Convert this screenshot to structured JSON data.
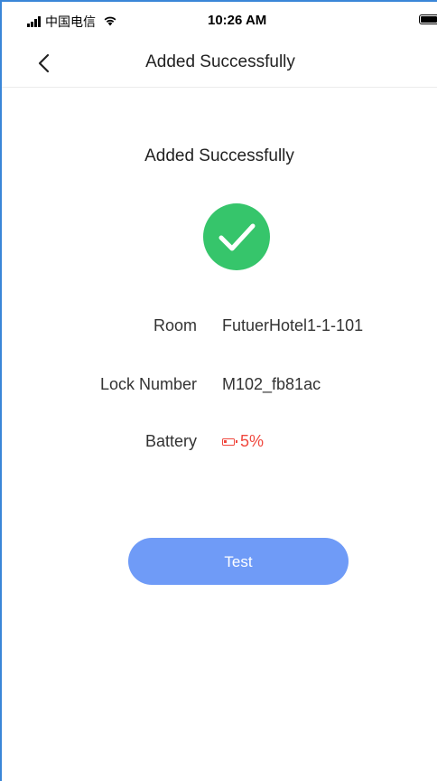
{
  "status_bar": {
    "carrier": "中国电信",
    "time": "10:26 AM",
    "wifi_glyph": "wifi-icon"
  },
  "nav": {
    "title": "Added Successfully",
    "back_icon": "chevron-left-icon"
  },
  "content": {
    "headline": "Added Successfully",
    "success_icon": "check-circle-icon",
    "success_color": "#36c56b",
    "rows": [
      {
        "label": "Room",
        "value": "FutuerHotel1-1-101"
      },
      {
        "label": "Lock Number",
        "value": "M102_fb81ac"
      },
      {
        "label": "Battery",
        "value": "5%"
      }
    ],
    "battery_color": "#f0483e",
    "battery_level": 0.05
  },
  "actions": {
    "test_label": "Test",
    "test_color": "#6f9bf7"
  }
}
